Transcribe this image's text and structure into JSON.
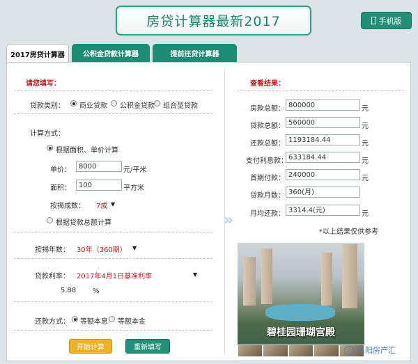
{
  "title": "房贷计算器最新2017",
  "mobile_button": "手机版",
  "tabs": [
    "2017房贷计算器",
    "公积金贷款计算器",
    "提前还贷计算器"
  ],
  "left": {
    "header": "请您填写：",
    "loan_type_label": "贷款类别：",
    "loan_types": [
      "商业贷款",
      "公积金贷款",
      "组合型贷款"
    ],
    "calc_method_label": "计算方式：",
    "by_area_label": "根据面积、单价计算",
    "unit_price_label": "单价：",
    "unit_price_value": "8000",
    "unit_price_unit": "元/平米",
    "area_label": "面积：",
    "area_value": "100",
    "area_unit": "平方米",
    "ratio_label": "按揭成数：",
    "ratio_value": "7成",
    "by_total_label": "根据贷款总额计算",
    "years_label": "按揭年数：",
    "years_value": "30年（360期）",
    "rate_label": "贷款利率：",
    "rate_value": "2017年4月1日基准利率",
    "rate_number": "5.88",
    "rate_unit": "%",
    "repay_label": "还款方式：",
    "repay_options": [
      "等额本息",
      "等额本金"
    ],
    "start_button": "开始计算",
    "reset_button": "重新填写"
  },
  "right": {
    "header": "查看结果：",
    "rows": [
      {
        "label": "房款总额：",
        "value": "800000",
        "unit": "元"
      },
      {
        "label": "贷款总额：",
        "value": "560000",
        "unit": "元"
      },
      {
        "label": "还款总额：",
        "value": "1193184.44",
        "unit": "元"
      },
      {
        "label": "支付利息款：",
        "value": "633184.44",
        "unit": "元"
      },
      {
        "label": "首期付款：",
        "value": "240000",
        "unit": "元"
      },
      {
        "label": "贷款月数：",
        "value": "360(月)",
        "unit": ""
      },
      {
        "label": "月均还款：",
        "value": "3314.4(元)",
        "unit": "元"
      }
    ],
    "note": "*以上结果仅供参考",
    "ad_caption": "碧桂园珊瑚宫殿"
  },
  "watermark": "阜阳房产汇"
}
